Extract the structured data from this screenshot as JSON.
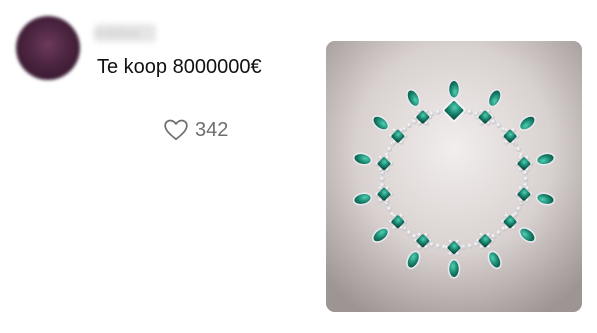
{
  "post": {
    "author_name": "onlinkra",
    "text": "Te koop 8000000€",
    "like_count": "342",
    "media_description": "emerald-and-diamond-necklace-photo",
    "like_icon": "heart-outline-icon"
  },
  "colors": {
    "text_primary": "#111111",
    "text_secondary": "#6e6e6e",
    "emerald": "#1f8a74",
    "background": "#ffffff"
  }
}
